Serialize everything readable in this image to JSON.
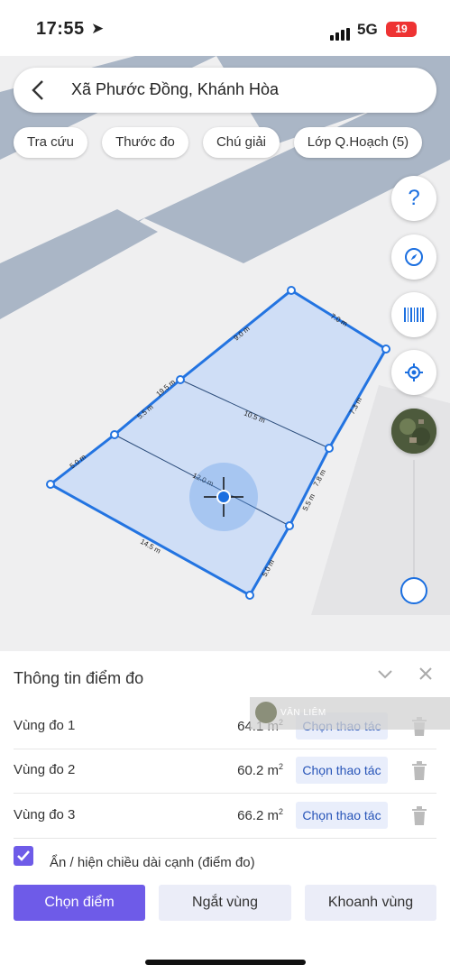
{
  "status_bar": {
    "time": "17:55",
    "network": "5G",
    "battery": "19"
  },
  "search": {
    "title": "Xã Phước Đồng, Khánh Hòa"
  },
  "chips": [
    {
      "label": "Tra cứu"
    },
    {
      "label": "Thước đo"
    },
    {
      "label": "Chú giải"
    },
    {
      "label": "Lớp Q.Hoạch (5)"
    }
  ],
  "map": {
    "edge_labels": [
      "9.0 m",
      "7.0 m",
      "7.3 m",
      "10.5 m",
      "5.5 m",
      "19.5 m",
      "5.0 m",
      "14.5 m",
      "5.0 m",
      "5.5 m",
      "7.8 m",
      "12.0 m"
    ],
    "colors": {
      "polygon_fill": "#c9dbf7",
      "polygon_stroke": "#2374e1",
      "road": "#aab6c6"
    }
  },
  "fab_buttons": [
    {
      "icon": "question-icon"
    },
    {
      "icon": "compass-icon"
    },
    {
      "icon": "barcode-icon"
    },
    {
      "icon": "locate-icon"
    },
    {
      "icon": "satellite-layer-icon"
    }
  ],
  "panel": {
    "title": "Thông tin điểm đo",
    "rows": [
      {
        "name": "Vùng đo 1",
        "area": "64.1 m",
        "unit_exp": "2",
        "action": "Chọn thao tác"
      },
      {
        "name": "Vùng đo 2",
        "area": "60.2 m",
        "unit_exp": "2",
        "action": "Chọn thao tác"
      },
      {
        "name": "Vùng đo 3",
        "area": "66.2 m",
        "unit_exp": "2",
        "action": "Chọn thao tác"
      }
    ],
    "toggle_label": "Ẩn / hiện chiều dài cạnh (điểm đo)",
    "buttons": {
      "select_point": "Chọn điểm",
      "split_region": "Ngắt vùng",
      "enclose_region": "Khoanh vùng"
    }
  },
  "watermark": {
    "name": "VĂN LIÊM"
  }
}
